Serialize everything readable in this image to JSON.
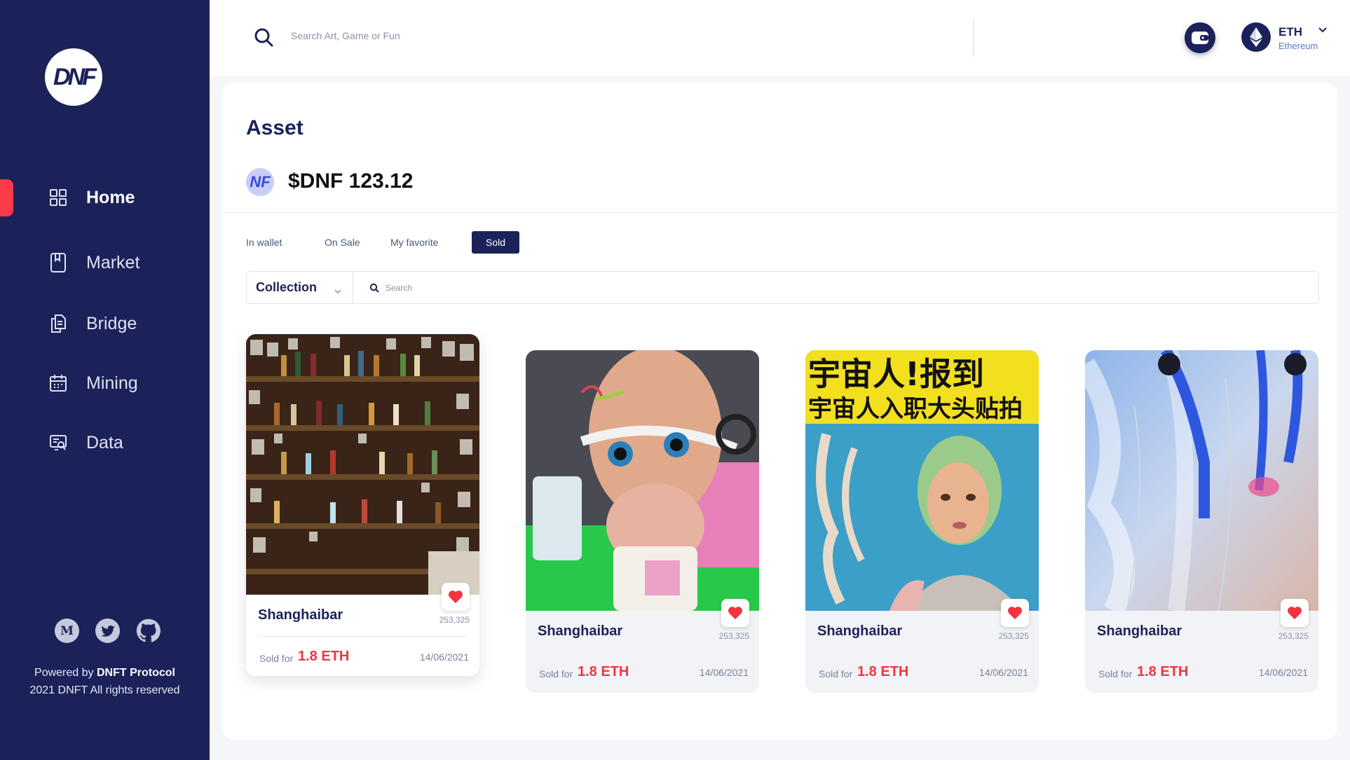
{
  "brand": {
    "logo_text": "DNF"
  },
  "sidebar": {
    "items": [
      {
        "label": "Home",
        "icon": "grid-icon"
      },
      {
        "label": "Market",
        "icon": "bookmark-icon"
      },
      {
        "label": "Bridge",
        "icon": "documents-icon"
      },
      {
        "label": "Mining",
        "icon": "calendar-icon"
      },
      {
        "label": "Data",
        "icon": "data-screen-icon"
      }
    ],
    "social": [
      {
        "name": "medium-icon",
        "glyph": "M"
      },
      {
        "name": "twitter-icon"
      },
      {
        "name": "github-icon"
      }
    ],
    "powered_prefix": "Powered by",
    "powered_brand": "DNFT Protocol",
    "copyright": "2021 DNFT All rights reserved"
  },
  "topbar": {
    "search_placeholder": "Search Art, Game or Fun",
    "network_symbol": "ETH",
    "network_name": "Ethereum"
  },
  "page": {
    "title": "Asset",
    "token_icon_text": "NF",
    "balance": "$DNF 123.12",
    "tabs": [
      "In wallet",
      "On Sale",
      "My favorite",
      "Sold"
    ],
    "active_tab": "Sold",
    "collection_label": "Collection",
    "filter_search_placeholder": "Search"
  },
  "cards": [
    {
      "name": "Shanghaibar",
      "likes": "253,325",
      "sold_for_label": "Sold for",
      "price": "1.8 ETH",
      "date": "14/06/2021",
      "art": "bar-shelves"
    },
    {
      "name": "Shanghaibar",
      "likes": "253,325",
      "sold_for_label": "Sold for",
      "price": "1.8 ETH",
      "date": "14/06/2021",
      "art": "mannequin-goggles"
    },
    {
      "name": "Shanghaibar",
      "likes": "253,325",
      "sold_for_label": "Sold for",
      "price": "1.8 ETH",
      "date": "14/06/2021",
      "art": "poster-face",
      "poster_line1": "宇宙人!报到",
      "poster_line2": "宇宙人入职大头贴拍"
    },
    {
      "name": "Shanghaibar",
      "likes": "253,325",
      "sold_for_label": "Sold for",
      "price": "1.8 ETH",
      "date": "14/06/2021",
      "art": "blue-abstract"
    }
  ],
  "colors": {
    "sidebar_bg": "#1b2259",
    "accent_red": "#f2343e",
    "active_bar": "#ff3b4a"
  }
}
